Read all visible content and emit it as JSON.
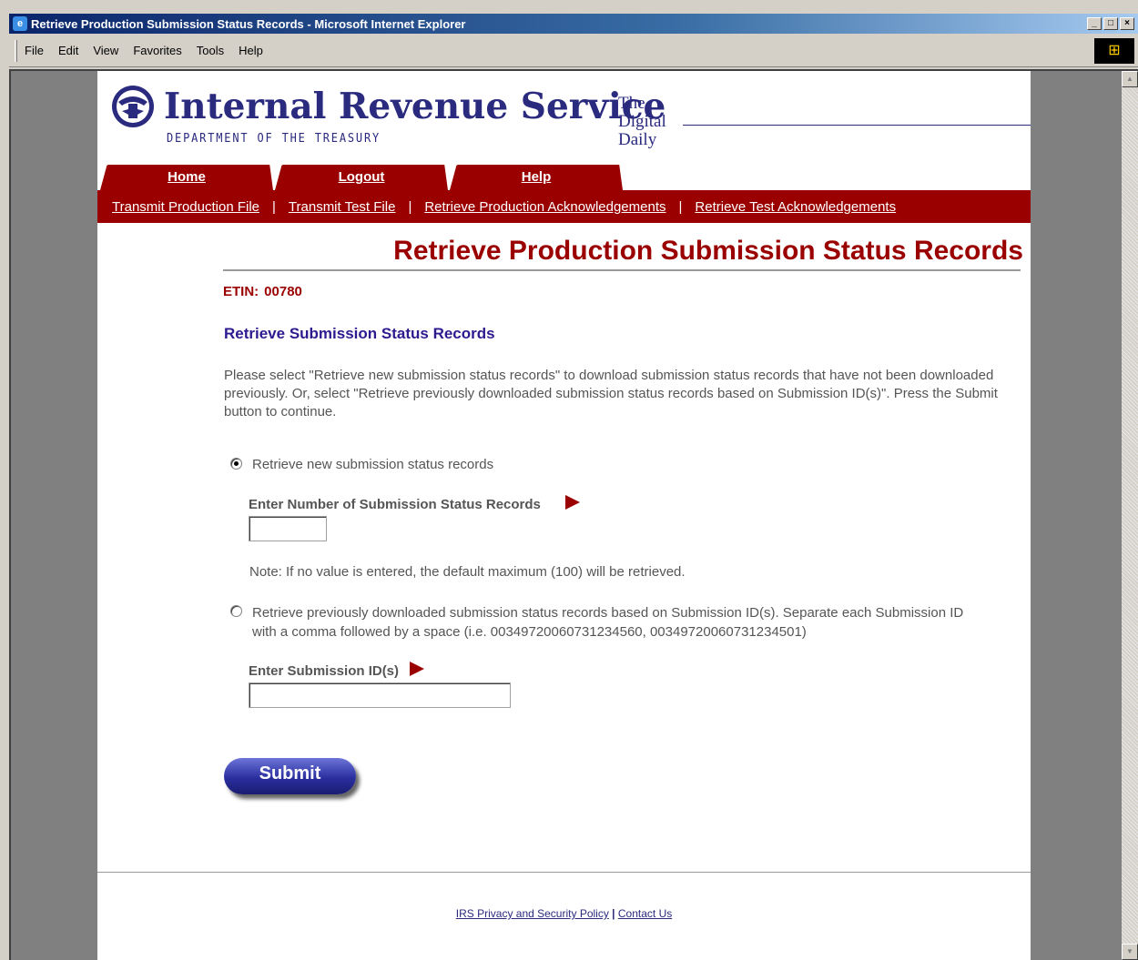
{
  "window": {
    "title": "Retrieve Production Submission Status Records - Microsoft Internet Explorer",
    "buttons": {
      "minimize": "_",
      "maximize": "□",
      "close": "×"
    }
  },
  "menu": [
    "File",
    "Edit",
    "View",
    "Favorites",
    "Tools",
    "Help"
  ],
  "header": {
    "agency": "Internal Revenue Service",
    "department": "DEPARTMENT OF THE TREASURY",
    "tagline_1": "The",
    "tagline_2": "Digital",
    "tagline_3": "Daily"
  },
  "tabs": [
    "Home",
    "Logout",
    "Help"
  ],
  "subnav": {
    "items": [
      "Transmit Production File",
      "Transmit Test File",
      "Retrieve Production Acknowledgements",
      "Retrieve Test Acknowledgements"
    ],
    "separator": "|"
  },
  "page": {
    "title": "Retrieve Production Submission Status Records",
    "etin_label": "ETIN:",
    "etin_value": "00780",
    "section_title": "Retrieve Submission Status Records",
    "intro": "Please select \"Retrieve new submission status records\" to download submission status records that have not been downloaded previously. Or, select \"Retrieve previously downloaded submission status records based on Submission ID(s)\". Press the Submit button to continue."
  },
  "option_new": {
    "label": "Retrieve new submission status records",
    "field_label": "Enter Number of Submission Status Records",
    "value": "",
    "note": "Note: If no value is entered, the default maximum (100) will be retrieved.",
    "selected": true
  },
  "option_previous": {
    "label": "Retrieve previously downloaded submission status records based on Submission ID(s). Separate each Submission ID with a comma followed by a space (i.e. 00349720060731234560, 00349720060731234501)",
    "field_label": "Enter Submission ID(s)",
    "value": "",
    "selected": false
  },
  "submit_label": "Submit",
  "footer": {
    "privacy": "IRS Privacy and Security Policy",
    "separator": "|",
    "contact": "Contact Us"
  }
}
